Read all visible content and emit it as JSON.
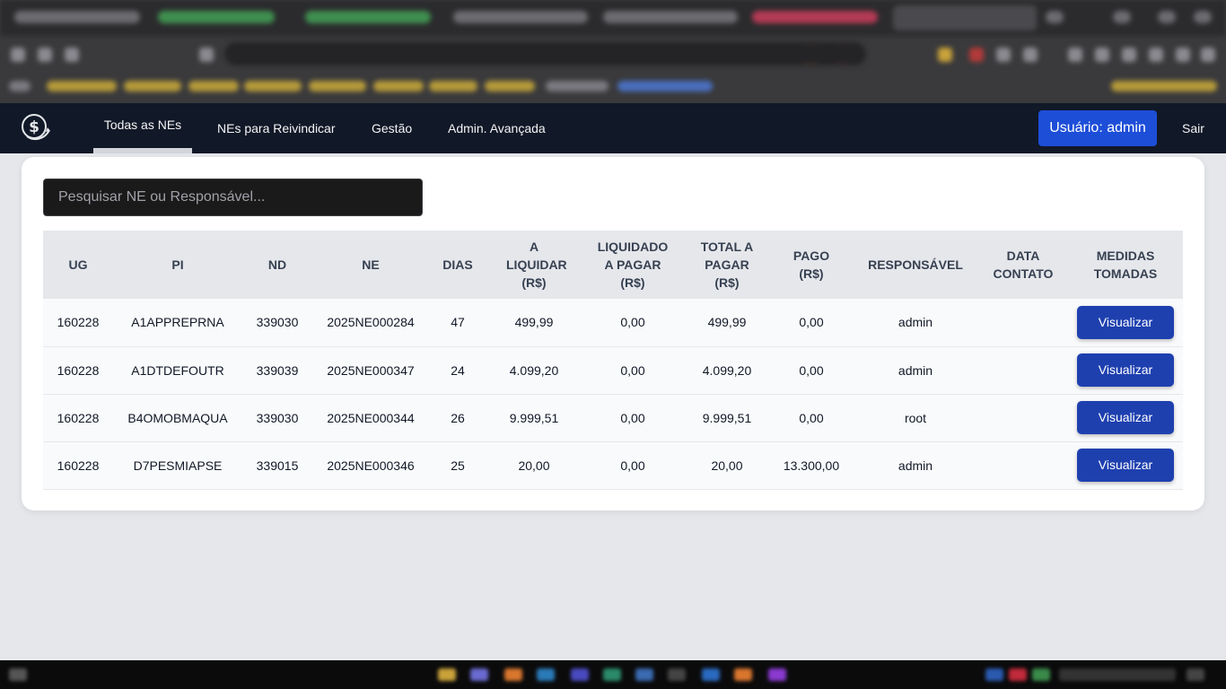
{
  "nav": {
    "items": [
      {
        "label": "Todas as NEs",
        "active": true
      },
      {
        "label": "NEs para Reivindicar",
        "active": false
      },
      {
        "label": "Gestão",
        "active": false
      },
      {
        "label": "Admin. Avançada",
        "active": false
      }
    ],
    "user_label": "Usuário: admin",
    "logout_label": "Sair",
    "logo_icon": "dollar-circle-icon"
  },
  "search": {
    "placeholder": "Pesquisar NE ou Responsável..."
  },
  "table": {
    "headers": {
      "ug": "UG",
      "pi": "PI",
      "nd": "ND",
      "ne": "NE",
      "dias": "DIAS",
      "a_liquidar": "A LIQUIDAR (R$)",
      "liquidado": "LIQUIDADO A PAGAR (R$)",
      "total": "TOTAL A PAGAR (R$)",
      "pago": "PAGO (R$)",
      "responsavel": "RESPONSÁVEL",
      "data_contato": "DATA CONTATO",
      "medidas": "MEDIDAS TOMADAS"
    },
    "rows": [
      {
        "ug": "160228",
        "pi": "A1APPREPRNA",
        "nd": "339030",
        "ne": "2025NE000284",
        "dias": "47",
        "a_liquidar": "499,99",
        "liquidado": "0,00",
        "total": "499,99",
        "pago": "0,00",
        "responsavel": "admin",
        "data_contato": "",
        "action": "Visualizar"
      },
      {
        "ug": "160228",
        "pi": "A1DTDEFOUTR",
        "nd": "339039",
        "ne": "2025NE000347",
        "dias": "24",
        "a_liquidar": "4.099,20",
        "liquidado": "0,00",
        "total": "4.099,20",
        "pago": "0,00",
        "responsavel": "admin",
        "data_contato": "",
        "action": "Visualizar"
      },
      {
        "ug": "160228",
        "pi": "B4OMOBMAQUA",
        "nd": "339030",
        "ne": "2025NE000344",
        "dias": "26",
        "a_liquidar": "9.999,51",
        "liquidado": "0,00",
        "total": "9.999,51",
        "pago": "0,00",
        "responsavel": "root",
        "data_contato": "",
        "action": "Visualizar"
      },
      {
        "ug": "160228",
        "pi": "D7PESMIAPSE",
        "nd": "339015",
        "ne": "2025NE000346",
        "dias": "25",
        "a_liquidar": "20,00",
        "liquidado": "0,00",
        "total": "20,00",
        "pago": "13.300,00",
        "responsavel": "admin",
        "data_contato": "",
        "action": "Visualizar"
      }
    ]
  },
  "colors": {
    "navbar_bg": "#111827",
    "primary_button": "#1d4ed8",
    "view_button": "#1e40af",
    "page_bg": "#e5e7eb"
  }
}
